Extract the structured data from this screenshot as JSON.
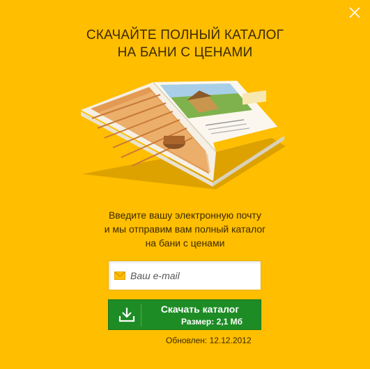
{
  "dialog": {
    "title_line1": "Скачайте полный каталог",
    "title_line2": "на бани с ценами",
    "description_line1": "Введите вашу электронную почту",
    "description_line2": "и мы отправим вам полный каталог",
    "description_line3": "на бани с ценами"
  },
  "email": {
    "value": "",
    "placeholder": "Ваш e-mail",
    "icon": "envelope-icon"
  },
  "download_button": {
    "label": "Скачать каталог",
    "size_text": "Размер: 2,1 Мб",
    "icon": "download-icon"
  },
  "updated_text": "Обновлен: 12.12.2012",
  "close_icon": "close-icon",
  "colors": {
    "background": "#FFBE00",
    "button": "#1E8C25",
    "text": "#3B2A00"
  }
}
